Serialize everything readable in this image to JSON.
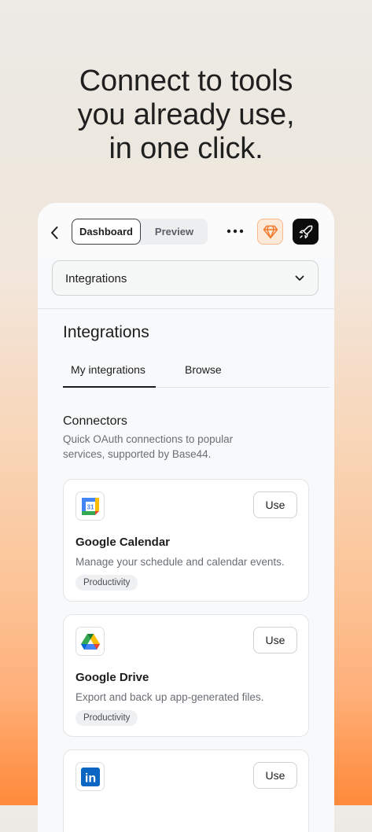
{
  "hero": {
    "headline": "Connect to tools\nyou already use,\nin one click."
  },
  "topbar": {
    "segments": [
      {
        "label": "Dashboard",
        "active": true
      },
      {
        "label": "Preview",
        "active": false
      }
    ],
    "icons": [
      "back-chevron-icon",
      "more-dots-icon",
      "gem-icon",
      "rocket-icon"
    ]
  },
  "page_select": {
    "value": "Integrations"
  },
  "section": {
    "title": "Integrations",
    "tabs": [
      {
        "label": "My integrations",
        "active": true
      },
      {
        "label": "Browse",
        "active": false
      }
    ]
  },
  "connectors": {
    "title": "Connectors",
    "description": "Quick OAuth connections to popular services, supported by Base44.",
    "items": [
      {
        "name": "Google Calendar",
        "description": "Manage your schedule and calendar events.",
        "tag": "Productivity",
        "action": "Use",
        "icon": "google-calendar-icon",
        "calendar_day": "31"
      },
      {
        "name": "Google Drive",
        "description": "Export and back up app-generated files.",
        "tag": "Productivity",
        "action": "Use",
        "icon": "google-drive-icon"
      },
      {
        "name": "",
        "description": "",
        "tag": "",
        "action": "Use",
        "icon": "linkedin-icon",
        "logo_text": "in"
      }
    ]
  },
  "colors": {
    "accent_orange": "#f07a2e",
    "linkedin_blue": "#0a66c2",
    "background_top": "#ecebe6",
    "background_bottom": "#ff8a3a"
  }
}
